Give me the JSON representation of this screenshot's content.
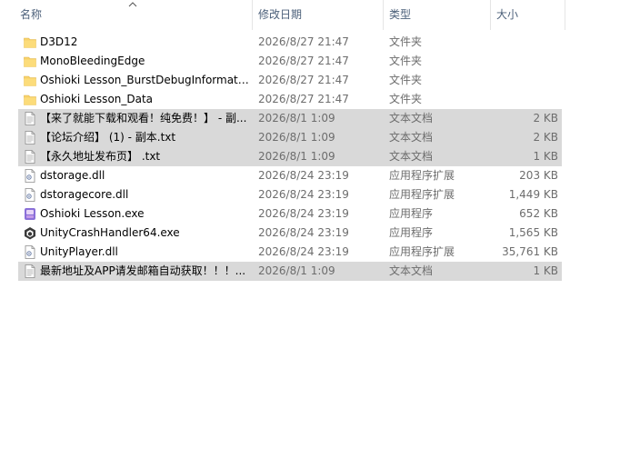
{
  "header": {
    "name": "名称",
    "date": "修改日期",
    "type": "类型",
    "size": "大小"
  },
  "files": [
    {
      "name": "D3D12",
      "date": "2026/8/27 21:47",
      "type": "文件夹",
      "size": "",
      "icon": "folder-icon",
      "selected": false
    },
    {
      "name": "MonoBleedingEdge",
      "date": "2026/8/27 21:47",
      "type": "文件夹",
      "size": "",
      "icon": "folder-icon",
      "selected": false
    },
    {
      "name": "Oshioki Lesson_BurstDebugInformati...",
      "date": "2026/8/27 21:47",
      "type": "文件夹",
      "size": "",
      "icon": "folder-icon",
      "selected": false
    },
    {
      "name": "Oshioki Lesson_Data",
      "date": "2026/8/27 21:47",
      "type": "文件夹",
      "size": "",
      "icon": "folder-icon",
      "selected": false
    },
    {
      "name": "【来了就能下载和观看！纯免费！】 - 副...",
      "date": "2026/8/1 1:09",
      "type": "文本文档",
      "size": "2 KB",
      "icon": "text-document-icon",
      "selected": true
    },
    {
      "name": "【论坛介绍】 (1) - 副本.txt",
      "date": "2026/8/1 1:09",
      "type": "文本文档",
      "size": "2 KB",
      "icon": "text-document-icon",
      "selected": true
    },
    {
      "name": "【永久地址发布页】 .txt",
      "date": "2026/8/1 1:09",
      "type": "文本文档",
      "size": "1 KB",
      "icon": "text-document-icon",
      "selected": true
    },
    {
      "name": "dstorage.dll",
      "date": "2026/8/24 23:19",
      "type": "应用程序扩展",
      "size": "203 KB",
      "icon": "dll-file-icon",
      "selected": false
    },
    {
      "name": "dstoragecore.dll",
      "date": "2026/8/24 23:19",
      "type": "应用程序扩展",
      "size": "1,449 KB",
      "icon": "dll-file-icon",
      "selected": false
    },
    {
      "name": "Oshioki Lesson.exe",
      "date": "2026/8/24 23:19",
      "type": "应用程序",
      "size": "652 KB",
      "icon": "game-exe-icon",
      "selected": false
    },
    {
      "name": "UnityCrashHandler64.exe",
      "date": "2026/8/24 23:19",
      "type": "应用程序",
      "size": "1,565 KB",
      "icon": "unity-icon",
      "selected": false
    },
    {
      "name": "UnityPlayer.dll",
      "date": "2026/8/24 23:19",
      "type": "应用程序扩展",
      "size": "35,761 KB",
      "icon": "dll-file-icon",
      "selected": false
    },
    {
      "name": "最新地址及APP请发邮箱自动获取！！！...",
      "date": "2026/8/1 1:09",
      "type": "文本文档",
      "size": "1 KB",
      "icon": "text-document-icon",
      "selected": true
    }
  ]
}
